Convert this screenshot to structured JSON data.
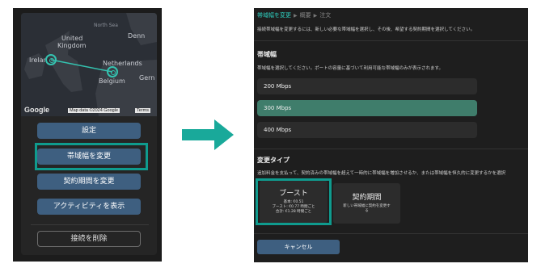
{
  "map": {
    "labels": {
      "north_sea": "North Sea",
      "united": "United",
      "kingdom": "Kingdom",
      "denmark": "Denn",
      "ireland": "Irelan",
      "netherlands": "Netherlands",
      "belgium": "Belgium",
      "germany": "Gern"
    },
    "google": "Google",
    "attribution": "Map data ©2024 Google",
    "terms": "Terms"
  },
  "menu": {
    "settings": "設定",
    "change_bandwidth": "帯域幅を変更",
    "change_term": "契約期間を変更",
    "show_activity": "アクティビティを表示",
    "delete_connection": "接続を削除"
  },
  "breadcrumb": {
    "active": "帯域幅を変更",
    "overview": "概要",
    "order": "注文"
  },
  "intro": "接続帯域幅を変更するには、新しい必要な帯域幅を選択し、その後、希望する契約期間を選択してください。",
  "bandwidth": {
    "title": "帯域幅",
    "description": "帯域幅を選択してください。ポートの容量に基づいて利用可能な帯域幅のみが表示されます。",
    "options": [
      "200 Mbps",
      "300 Mbps",
      "400 Mbps"
    ],
    "selected": "300 Mbps"
  },
  "change_type": {
    "title": "変更タイプ",
    "description": "追加料金を支払って、契約済みの帯域幅を超えて一時的に帯域幅を増加させるか、または帯域幅を恒久的に変更するかを選択",
    "boost": {
      "title": "ブースト",
      "line1": "基本: €0.51",
      "line2": "ブースト: €0.77 時間ごと",
      "line3": "合計: €1.28 時間ごと"
    },
    "term": {
      "title": "契約期間",
      "line1": "新しい帯域幅に契約を変更す",
      "line2": "る"
    }
  },
  "cancel": "キャンセル",
  "colors": {
    "accent": "#0f9b8e",
    "button": "#3e5f80",
    "selected_option": "#3f7d6b"
  }
}
